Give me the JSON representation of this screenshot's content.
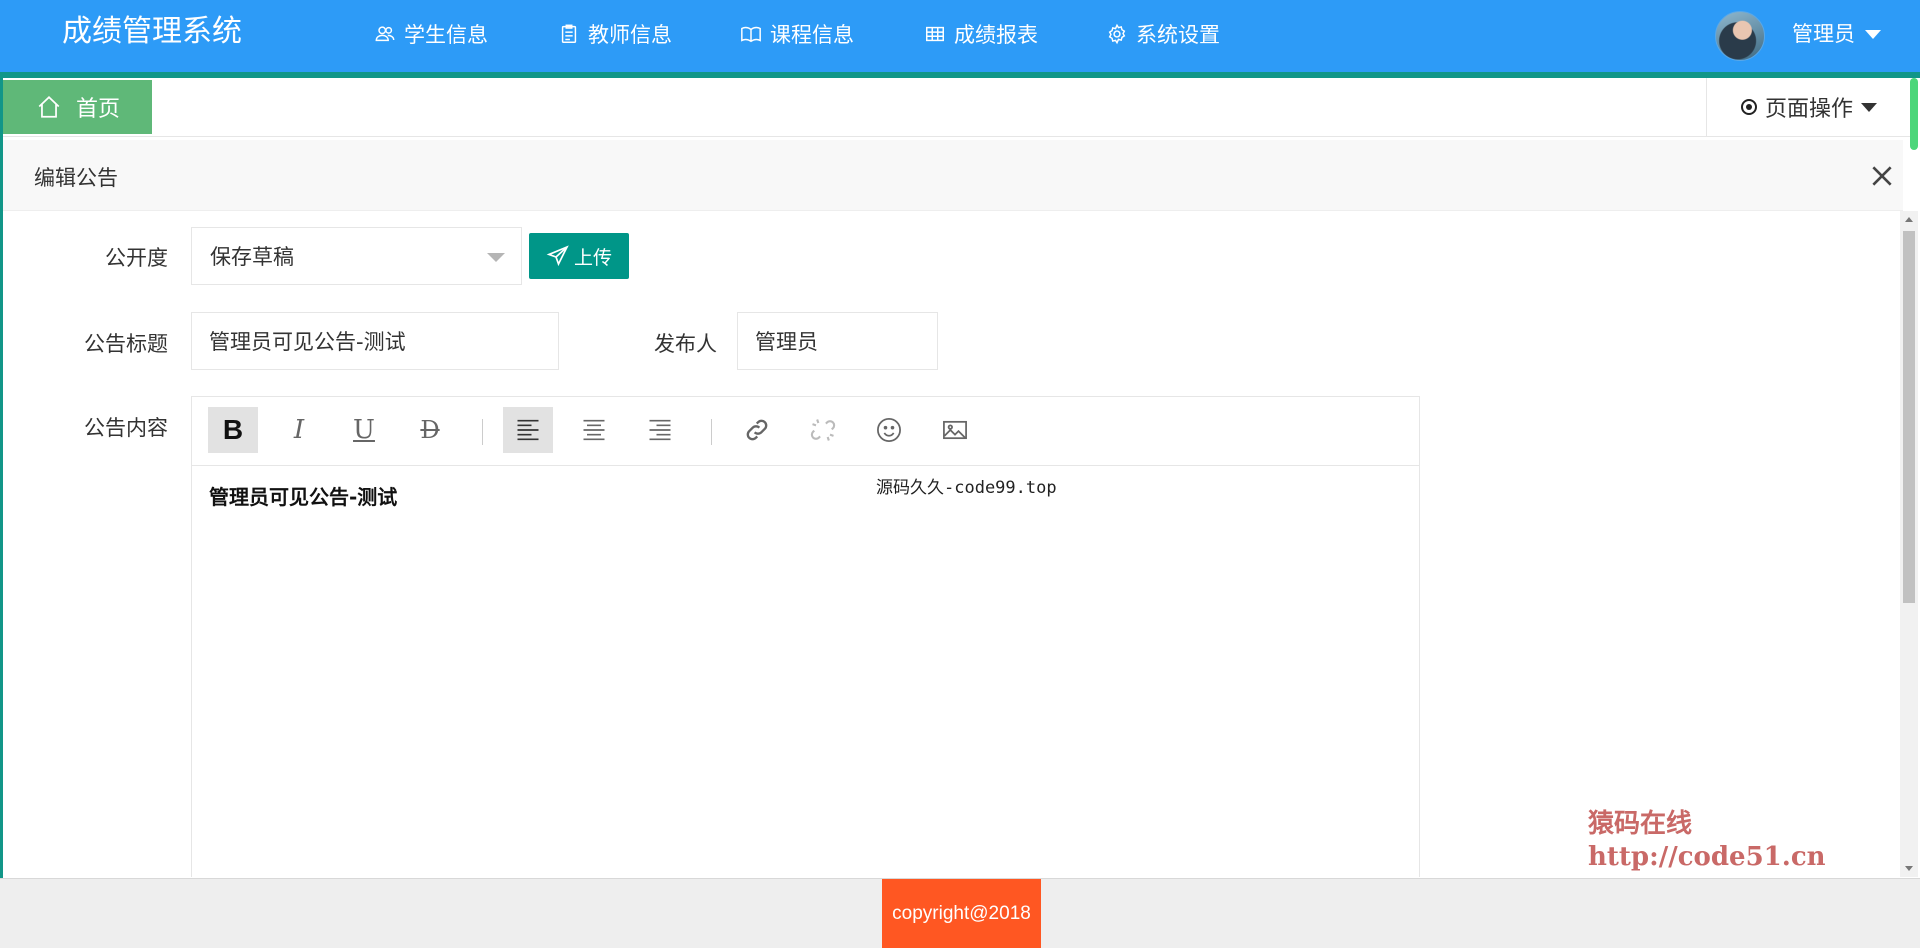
{
  "header": {
    "brand": "成绩管理系统",
    "nav": [
      {
        "label": "学生信息",
        "icon": "users-icon"
      },
      {
        "label": "教师信息",
        "icon": "clipboard-icon"
      },
      {
        "label": "课程信息",
        "icon": "book-icon"
      },
      {
        "label": "成绩报表",
        "icon": "table-icon"
      },
      {
        "label": "系统设置",
        "icon": "gear-icon"
      }
    ],
    "user": "管理员"
  },
  "tabs": {
    "home_label": "首页",
    "page_ops_label": "页面操作"
  },
  "dialog": {
    "title": "编辑公告",
    "form": {
      "visibility_label": "公开度",
      "visibility_value": "保存草稿",
      "upload_label": "上传",
      "title_label": "公告标题",
      "title_value": "管理员可见公告-测试",
      "publisher_label": "发布人",
      "publisher_value": "管理员",
      "content_label": "公告内容",
      "content_value": "管理员可见公告-测试"
    },
    "editor_tools": [
      "bold",
      "italic",
      "underline",
      "strikethrough",
      "align-left",
      "align-center",
      "align-right",
      "link",
      "unlink",
      "emoji",
      "image"
    ]
  },
  "watermarks": {
    "center": "源码久久-code99.top",
    "corner_line1": "猿码在线",
    "corner_line2": "http://code51.cn"
  },
  "footer": {
    "copyright": "copyright@2018"
  },
  "colors": {
    "topbar": "#2d9bf7",
    "accent": "#119688",
    "home_tab": "#5fb878",
    "primary_button": "#009688",
    "copyright_bg": "#ff5722"
  }
}
